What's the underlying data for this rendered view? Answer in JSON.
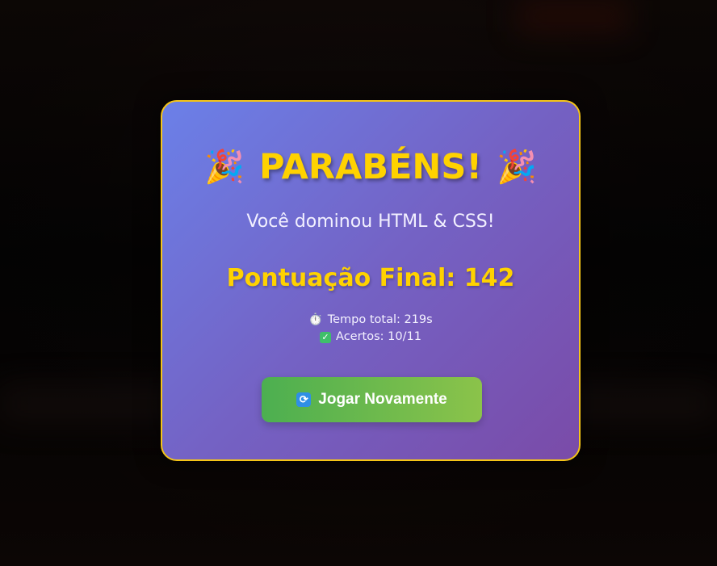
{
  "modal": {
    "title": "PARABÉNS!",
    "title_icon": "party-popper-icon",
    "subtitle": "Você dominou HTML & CSS!",
    "score_text": "Pontuação Final: 142",
    "stats": {
      "time_icon": "stopwatch-icon",
      "time_text": "Tempo total: 219s",
      "hits_icon": "check-icon",
      "hits_text": "Acertos: 10/11"
    },
    "button": {
      "icon": "refresh-icon",
      "label": "Jogar Novamente"
    }
  },
  "colors": {
    "accent_gold": "#ffd200",
    "border_gold": "#f5c518",
    "modal_gradient_start": "#6b80e8",
    "modal_gradient_end": "#7a4ba8",
    "button_gradient_start": "#4caf50",
    "button_gradient_end": "#8bc34a"
  }
}
